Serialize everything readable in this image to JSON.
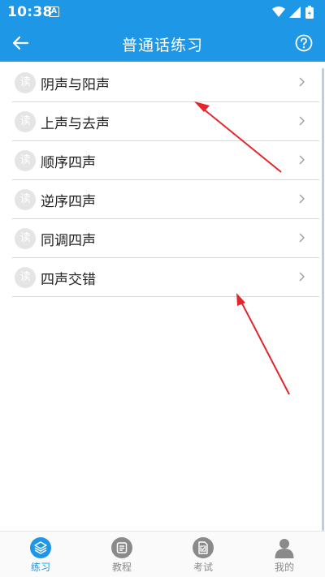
{
  "status_bar": {
    "time": "10:38",
    "notification_icon": "A"
  },
  "app_bar": {
    "title": "普通话练习"
  },
  "badge_text": "读",
  "items": [
    {
      "label": "阴声与阳声"
    },
    {
      "label": "上声与去声"
    },
    {
      "label": "顺序四声"
    },
    {
      "label": "逆序四声"
    },
    {
      "label": "同调四声"
    },
    {
      "label": "四声交错"
    }
  ],
  "tabs": [
    {
      "label": "练习",
      "icon": "layers-icon",
      "active": true
    },
    {
      "label": "教程",
      "icon": "document-icon",
      "active": false
    },
    {
      "label": "考试",
      "icon": "exam-icon",
      "active": false
    },
    {
      "label": "我的",
      "icon": "profile-icon",
      "active": false
    }
  ],
  "colors": {
    "primary": "#1e97e6",
    "annotation_arrow": "#e3262b",
    "inactive_tab": "#8a8a8a"
  }
}
